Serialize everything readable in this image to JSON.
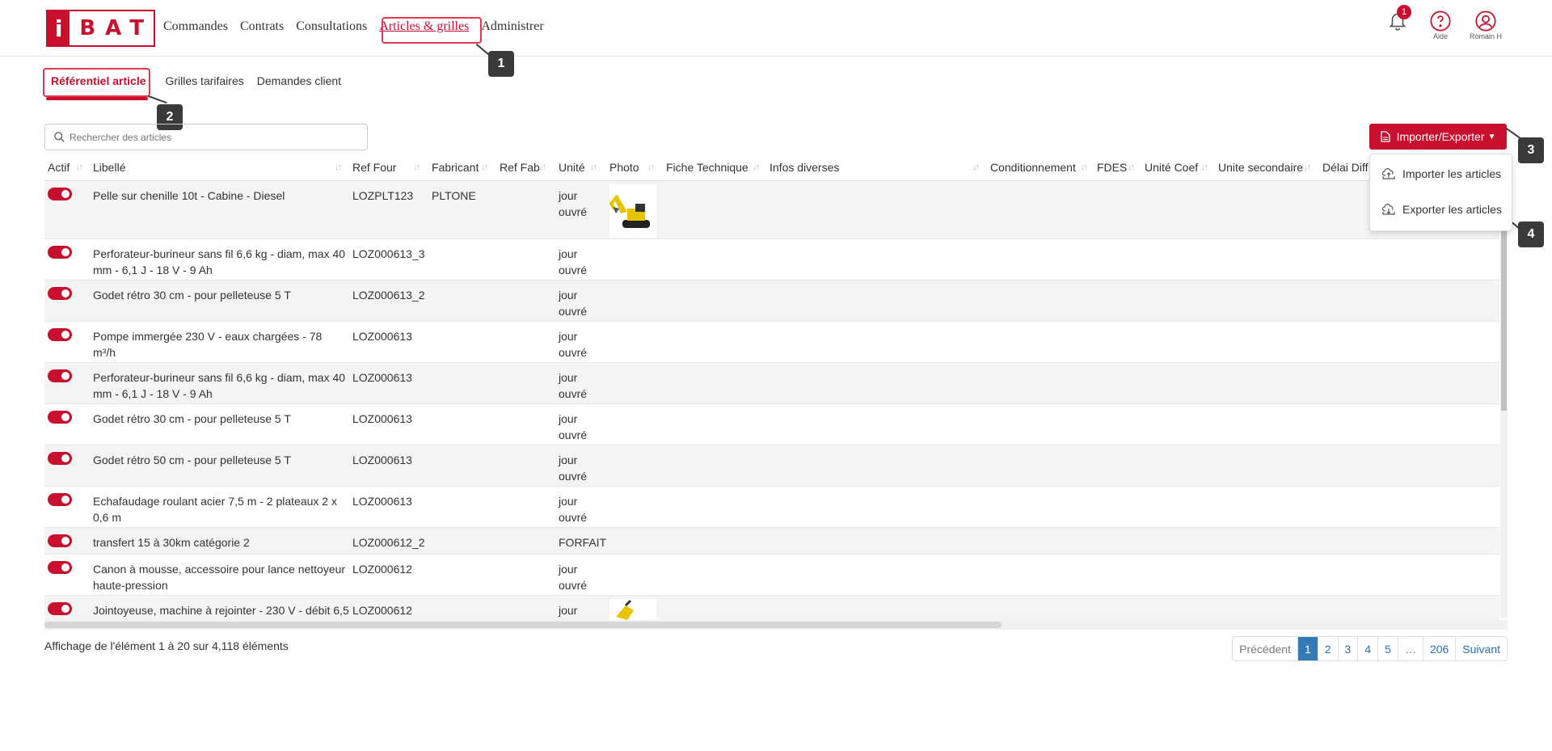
{
  "brand": {
    "letter": "i",
    "rest": "BAT",
    "color": "#c8102e"
  },
  "nav": {
    "items": [
      "Commandes",
      "Contrats",
      "Consultations",
      "Articles & grilles",
      "Administrer"
    ],
    "active_index": 3
  },
  "top_icons": {
    "notifications_count": "1",
    "help_label": "Aide",
    "user_label": "Romain H"
  },
  "subtabs": {
    "items": [
      "Référentiel article",
      "Grilles tarifaires",
      "Demandes client"
    ],
    "active_index": 0
  },
  "search": {
    "placeholder": "Rechercher des articles"
  },
  "import_export": {
    "button_label": "Importer/Exporter",
    "menu": [
      "Importer les articles",
      "Exporter les articles"
    ]
  },
  "table": {
    "columns": [
      "Actif",
      "Libellé",
      "Ref Four",
      "Fabricant",
      "Ref Fab",
      "Unité",
      "Photo",
      "Fiche Technique",
      "Infos diverses",
      "Conditionnement",
      "FDES",
      "Unité Coef",
      "Unite secondaire",
      "Délai Diff"
    ],
    "rows": [
      {
        "libelle": [
          "Pelle sur chenille 10t - Cabine - Diesel",
          ""
        ],
        "ref_four": "LOZPLT123",
        "fabricant": "PLTONE",
        "unite": [
          "jour",
          "ouvré"
        ],
        "photo": "excavator"
      },
      {
        "libelle": [
          "Perforateur-burineur sans fil 6,6 kg - diam, max 40",
          "mm - 6,1 J - 18 V - 9 Ah"
        ],
        "ref_four": "LOZ000613_3",
        "fabricant": "",
        "unite": [
          "jour",
          "ouvré"
        ],
        "photo": ""
      },
      {
        "libelle": [
          "Godet rétro 30 cm - pour pelleteuse 5 T",
          ""
        ],
        "ref_four": "LOZ000613_2",
        "fabricant": "",
        "unite": [
          "jour",
          "ouvré"
        ],
        "photo": ""
      },
      {
        "libelle": [
          "Pompe immergée 230 V - eaux chargées - 78",
          "m³/h"
        ],
        "ref_four": "LOZ000613",
        "fabricant": "",
        "unite": [
          "jour",
          "ouvré"
        ],
        "photo": ""
      },
      {
        "libelle": [
          "Perforateur-burineur sans fil 6,6 kg - diam, max 40",
          "mm - 6,1 J - 18 V - 9 Ah"
        ],
        "ref_four": "LOZ000613",
        "fabricant": "",
        "unite": [
          "jour",
          "ouvré"
        ],
        "photo": ""
      },
      {
        "libelle": [
          "Godet rétro 30 cm - pour pelleteuse 5 T",
          ""
        ],
        "ref_four": "LOZ000613",
        "fabricant": "",
        "unite": [
          "jour",
          "ouvré"
        ],
        "photo": ""
      },
      {
        "libelle": [
          "Godet rétro 50 cm - pour pelleteuse 5 T",
          ""
        ],
        "ref_four": "LOZ000613",
        "fabricant": "",
        "unite": [
          "jour",
          "ouvré"
        ],
        "photo": ""
      },
      {
        "libelle": [
          "Echafaudage roulant acier 7,5 m - 2 plateaux 2 x",
          "0,6 m"
        ],
        "ref_four": "LOZ000613",
        "fabricant": "",
        "unite": [
          "jour",
          "ouvré"
        ],
        "photo": ""
      },
      {
        "libelle": [
          "transfert 15 à 30km catégorie 2",
          ""
        ],
        "ref_four": "LOZ000612_2",
        "fabricant": "",
        "unite": [
          "FORFAIT",
          ""
        ],
        "photo": ""
      },
      {
        "libelle": [
          "Canon à mousse, accessoire pour lance nettoyeur",
          "haute-pression"
        ],
        "ref_four": "LOZ000612",
        "fabricant": "",
        "unite": [
          "jour",
          "ouvré"
        ],
        "photo": ""
      },
      {
        "libelle": [
          "Jointoyeuse, machine à rejointer - 230 V - débit 6,5",
          ""
        ],
        "ref_four": "LOZ000612",
        "fabricant": "",
        "unite": [
          "jour",
          ""
        ],
        "photo": "tool"
      }
    ]
  },
  "footer": {
    "info": "Affichage de l'élément 1 à 20 sur 4,118 éléments",
    "pagination": [
      "Précédent",
      "1",
      "2",
      "3",
      "4",
      "5",
      "…",
      "206",
      "Suivant"
    ],
    "active_page": "1"
  },
  "callouts": [
    "1",
    "2",
    "3",
    "4"
  ]
}
